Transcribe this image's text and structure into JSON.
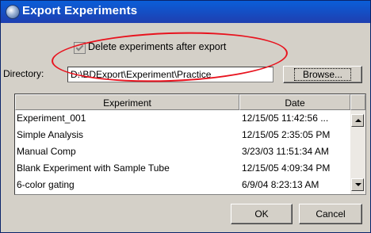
{
  "dialog": {
    "title": "Export Experiments"
  },
  "options": {
    "delete_label": "Delete experiments after export",
    "delete_checked": true
  },
  "directory": {
    "label": "Directory:",
    "value": "D:\\BDExport\\Experiment\\Practice",
    "browse_label": "Browse..."
  },
  "table": {
    "columns": [
      "Experiment",
      "Date"
    ],
    "rows": [
      {
        "name": "Experiment_001",
        "date": "12/15/05 11:42:56 ..."
      },
      {
        "name": "Simple Analysis",
        "date": "12/15/05 2:35:05 PM"
      },
      {
        "name": "Manual Comp",
        "date": "3/23/03 11:51:34 AM"
      },
      {
        "name": "Blank Experiment with Sample Tube",
        "date": "12/15/05 4:09:34 PM"
      },
      {
        "name": "6-color gating",
        "date": "6/9/04 8:23:13 AM"
      }
    ]
  },
  "buttons": {
    "ok": "OK",
    "cancel": "Cancel"
  },
  "icons": {
    "title": "app-globe-icon",
    "scroll_up": "arrow-up-icon",
    "scroll_down": "arrow-down-icon"
  },
  "colors": {
    "titlebar": "#0a5ed8",
    "annotation": "#e8131e",
    "dialog_bg": "#d4d0c8"
  }
}
